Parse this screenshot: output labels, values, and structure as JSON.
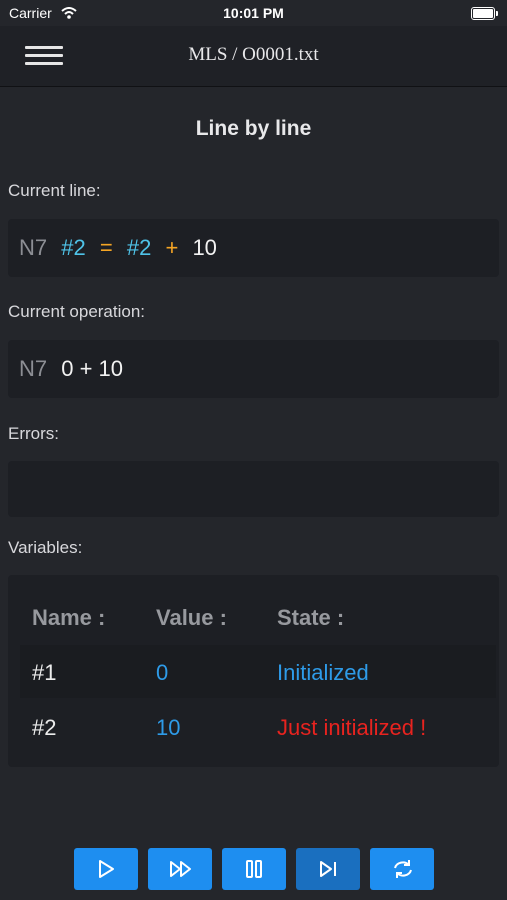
{
  "status_bar": {
    "carrier": "Carrier",
    "time": "10:01 PM"
  },
  "nav": {
    "title": "MLS / O0001.txt",
    "menu_icon": "hamburger-icon"
  },
  "page_title": "Line by line",
  "current_line": {
    "label": "Current line:",
    "tokens": {
      "line_number": "N7",
      "target": "#2",
      "op_assign": "=",
      "operand": "#2",
      "op_plus": "+",
      "literal": "10"
    }
  },
  "current_operation": {
    "label": "Current operation:",
    "line_number": "N7",
    "expression": "0 + 10"
  },
  "errors": {
    "label": "Errors:",
    "text": ""
  },
  "variables": {
    "label": "Variables:",
    "headers": {
      "name": "Name :",
      "value": "Value :",
      "state": "State :"
    },
    "rows": [
      {
        "name": "#1",
        "value": "0",
        "state": "Initialized"
      },
      {
        "name": "#2",
        "value": "10",
        "state": "Just initialized !"
      }
    ]
  },
  "toolbar": {
    "buttons": [
      {
        "icon": "play-icon"
      },
      {
        "icon": "fast-forward-icon"
      },
      {
        "icon": "pause-icon"
      },
      {
        "icon": "step-forward-icon"
      },
      {
        "icon": "refresh-icon"
      }
    ]
  },
  "colors": {
    "background": "#24262b",
    "accent": "#1e8ef0",
    "variable": "#4fc3e8",
    "operator": "#f5a524",
    "value": "#2e9be8",
    "warning": "#e8231f"
  }
}
